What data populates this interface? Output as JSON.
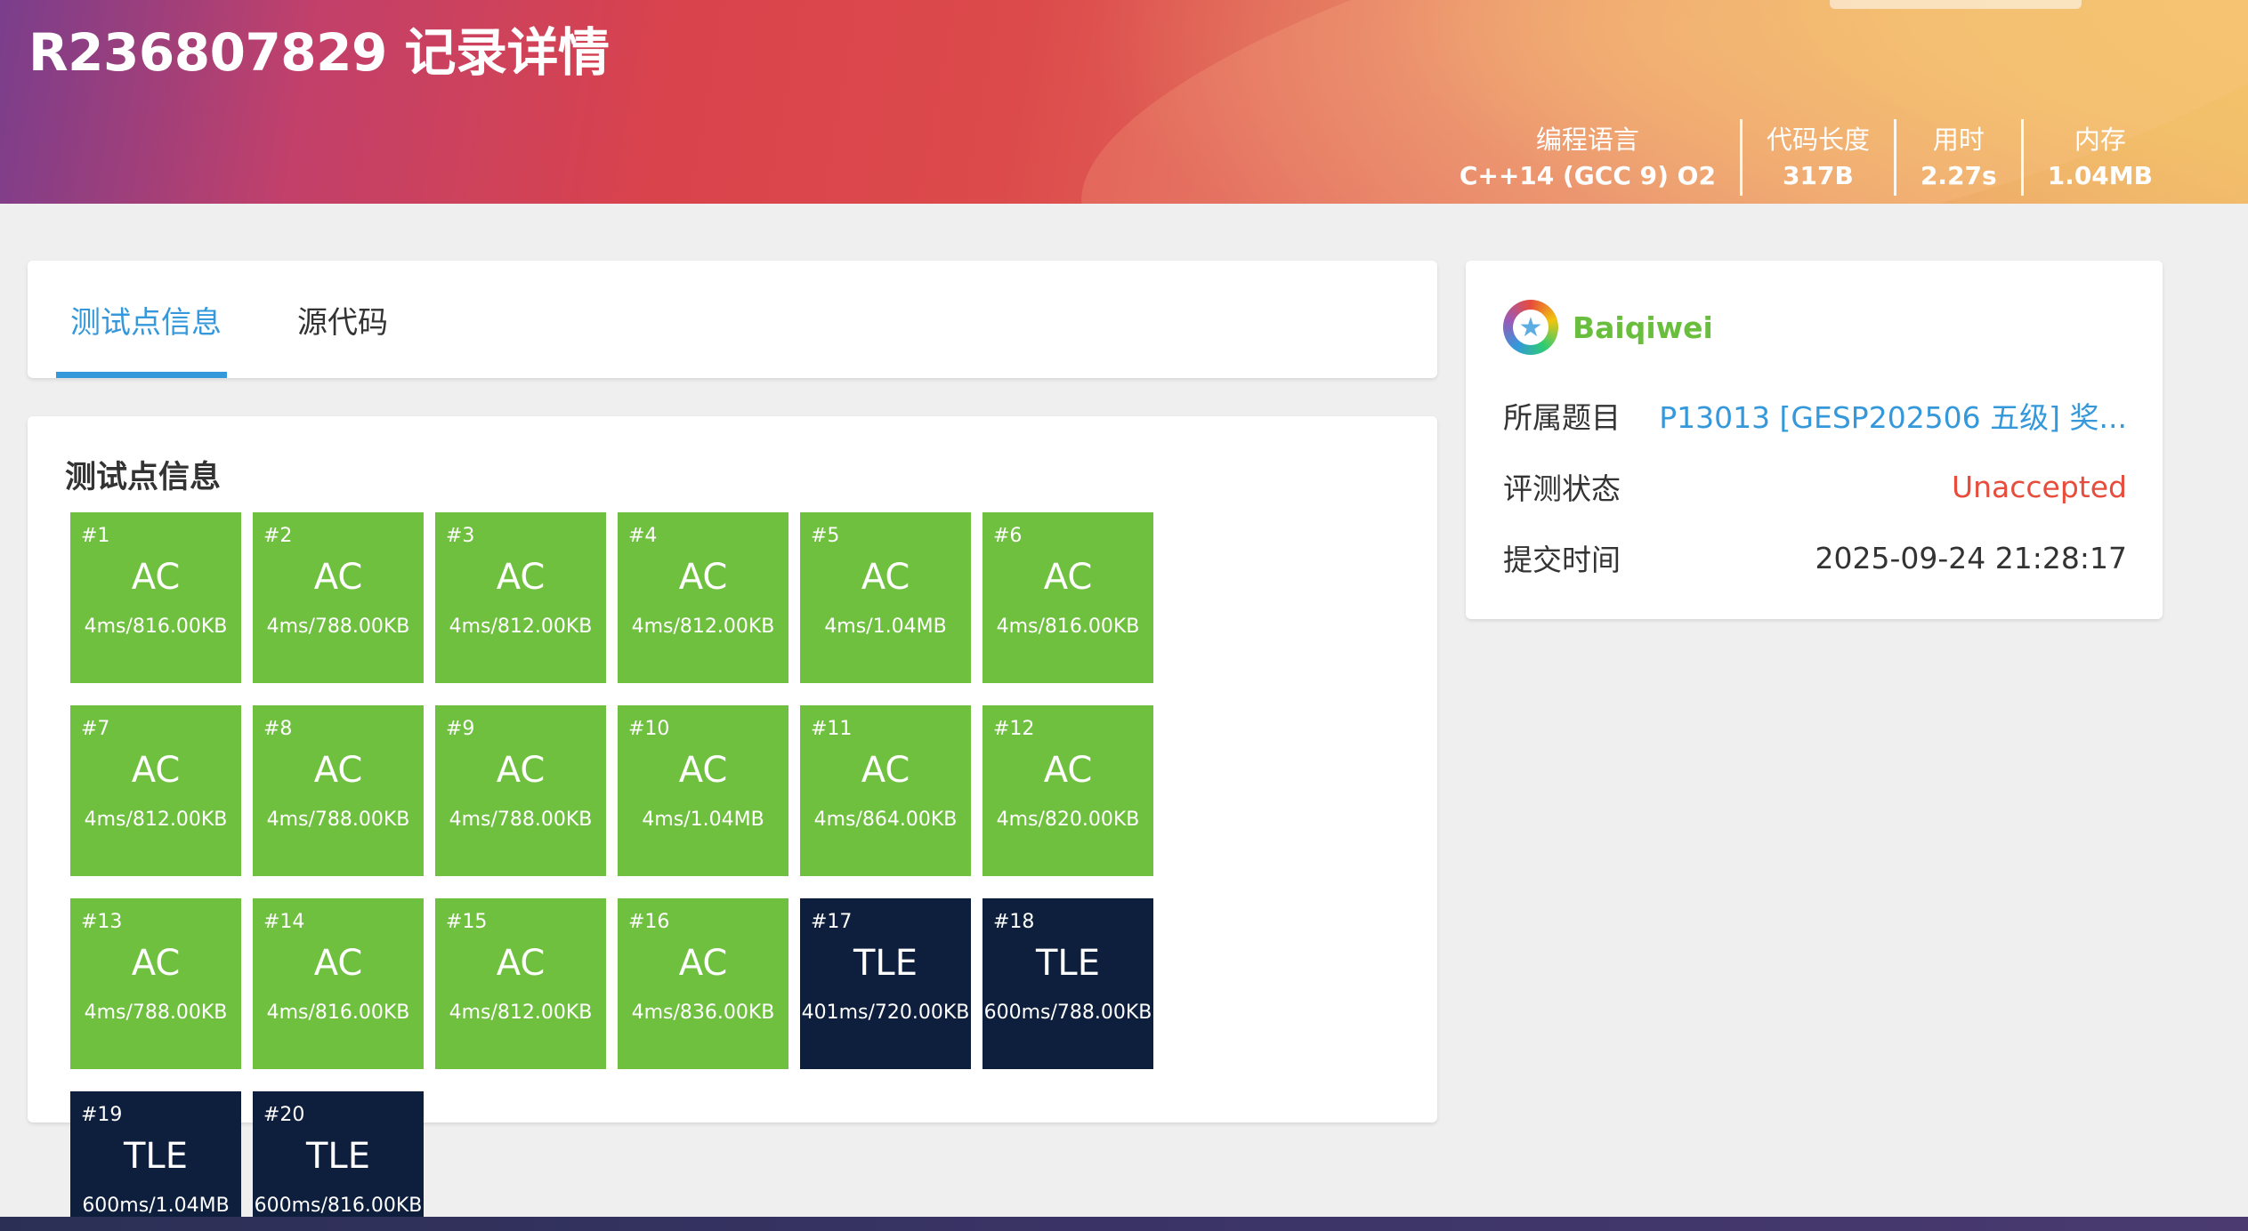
{
  "header": {
    "title": "R236807829 记录详情",
    "stats": [
      {
        "label": "编程语言",
        "value": "C++14 (GCC 9) O2"
      },
      {
        "label": "代码长度",
        "value": "317B"
      },
      {
        "label": "用时",
        "value": "2.27s"
      },
      {
        "label": "内存",
        "value": "1.04MB"
      }
    ]
  },
  "tabs": [
    {
      "label": "测试点信息",
      "active": true
    },
    {
      "label": "源代码",
      "active": false
    }
  ],
  "tests_section": {
    "title": "测试点信息",
    "cases": [
      {
        "id": "#1",
        "status": "AC",
        "detail": "4ms/816.00KB"
      },
      {
        "id": "#2",
        "status": "AC",
        "detail": "4ms/788.00KB"
      },
      {
        "id": "#3",
        "status": "AC",
        "detail": "4ms/812.00KB"
      },
      {
        "id": "#4",
        "status": "AC",
        "detail": "4ms/812.00KB"
      },
      {
        "id": "#5",
        "status": "AC",
        "detail": "4ms/1.04MB"
      },
      {
        "id": "#6",
        "status": "AC",
        "detail": "4ms/816.00KB"
      },
      {
        "id": "#7",
        "status": "AC",
        "detail": "4ms/812.00KB"
      },
      {
        "id": "#8",
        "status": "AC",
        "detail": "4ms/788.00KB"
      },
      {
        "id": "#9",
        "status": "AC",
        "detail": "4ms/788.00KB"
      },
      {
        "id": "#10",
        "status": "AC",
        "detail": "4ms/1.04MB"
      },
      {
        "id": "#11",
        "status": "AC",
        "detail": "4ms/864.00KB"
      },
      {
        "id": "#12",
        "status": "AC",
        "detail": "4ms/820.00KB"
      },
      {
        "id": "#13",
        "status": "AC",
        "detail": "4ms/788.00KB"
      },
      {
        "id": "#14",
        "status": "AC",
        "detail": "4ms/816.00KB"
      },
      {
        "id": "#15",
        "status": "AC",
        "detail": "4ms/812.00KB"
      },
      {
        "id": "#16",
        "status": "AC",
        "detail": "4ms/836.00KB"
      },
      {
        "id": "#17",
        "status": "TLE",
        "detail": "401ms/720.00KB"
      },
      {
        "id": "#18",
        "status": "TLE",
        "detail": "600ms/788.00KB"
      },
      {
        "id": "#19",
        "status": "TLE",
        "detail": "600ms/1.04MB"
      },
      {
        "id": "#20",
        "status": "TLE",
        "detail": "600ms/816.00KB"
      }
    ]
  },
  "info": {
    "username": "Baiqiwei",
    "avatar_icon": "star-avatar-icon",
    "rows": [
      {
        "label": "所属题目",
        "value": "P13013 [GESP202506 五级] 奖..."
      },
      {
        "label": "评测状态",
        "value": "Unaccepted"
      },
      {
        "label": "提交时间",
        "value": "2025-09-24 21:28:17"
      }
    ]
  },
  "colors": {
    "ac": "#70c040",
    "tle": "#0e1f3d",
    "accent": "#3498db",
    "unaccepted": "#e74c3c",
    "username": "#6abe3e"
  }
}
